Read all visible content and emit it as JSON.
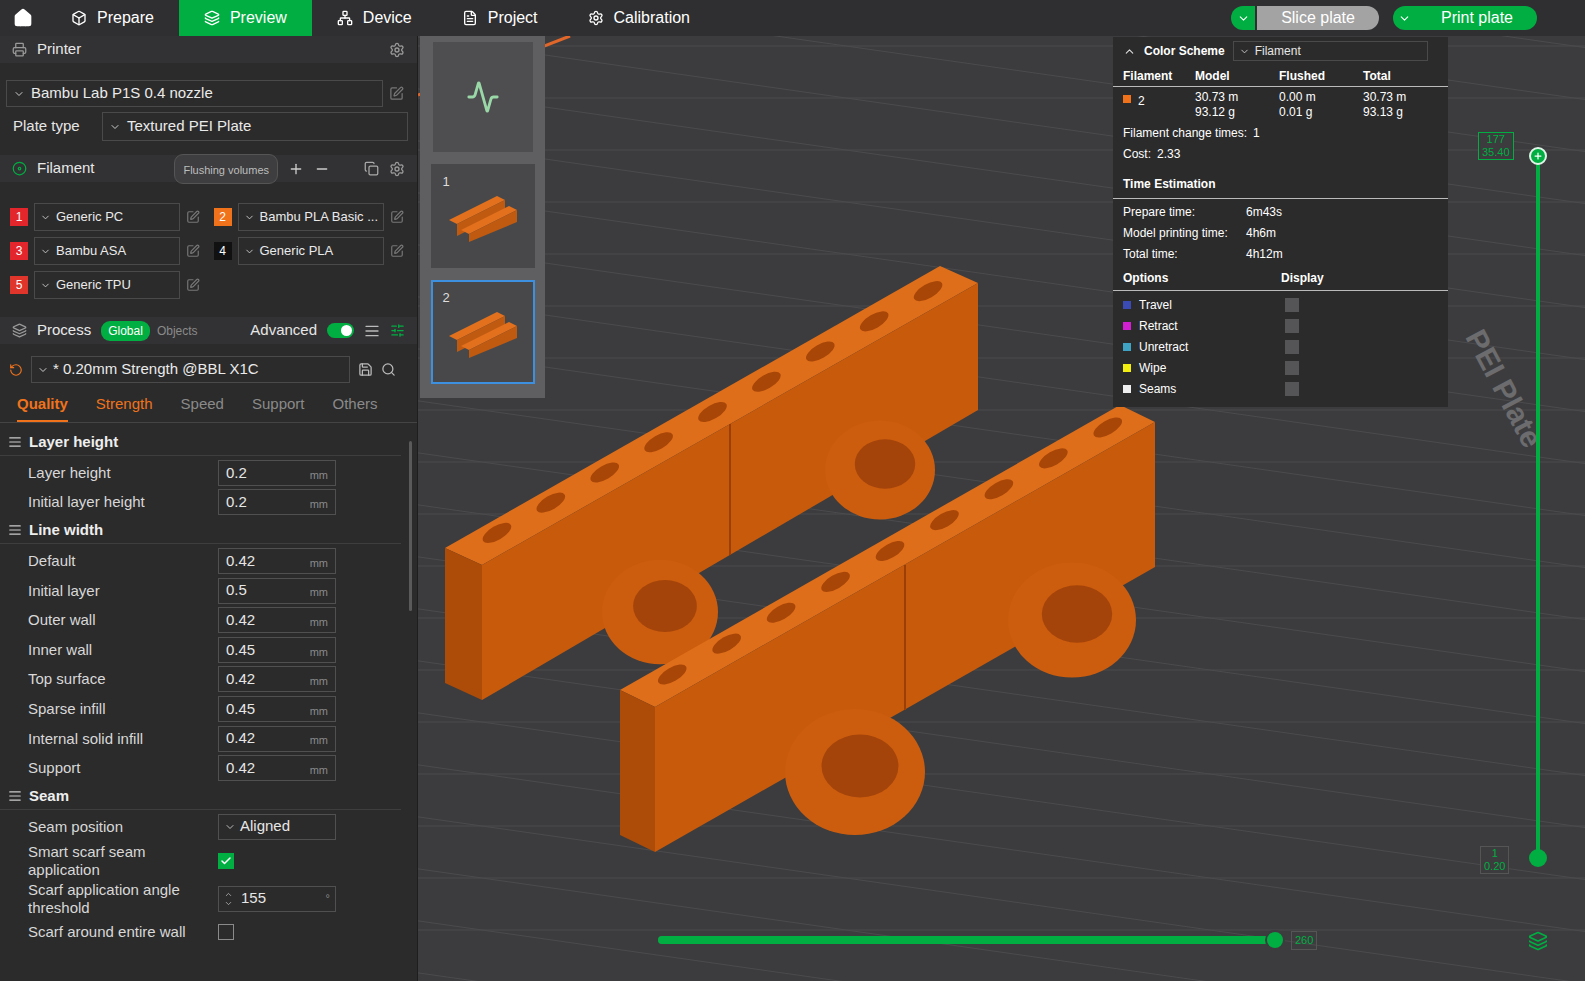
{
  "nav": {
    "tabs": [
      {
        "label": "Prepare",
        "selected": false
      },
      {
        "label": "Preview",
        "selected": true
      },
      {
        "label": "Device",
        "selected": false
      },
      {
        "label": "Project",
        "selected": false
      },
      {
        "label": "Calibration",
        "selected": false
      }
    ],
    "buttons": [
      {
        "label": "Slice plate",
        "primary": false
      },
      {
        "label": "Print plate",
        "primary": true
      }
    ]
  },
  "printer": {
    "title": "Printer",
    "preset": "Bambu Lab P1S 0.4 nozzle",
    "plate_type_label": "Plate type",
    "plate_type": "Textured PEI Plate"
  },
  "filament": {
    "title": "Filament",
    "flushing_button": "Flushing volumes",
    "items": [
      {
        "index": "1",
        "name": "Generic PC",
        "color": "#e3262b"
      },
      {
        "index": "2",
        "name": "Bambu PLA Basic ...",
        "color": "#f0731c"
      },
      {
        "index": "3",
        "name": "Bambu ASA",
        "color": "#e3262b"
      },
      {
        "index": "4",
        "name": "Generic PLA",
        "color": "#111111"
      },
      {
        "index": "5",
        "name": "Generic TPU",
        "color": "#e0352b"
      }
    ]
  },
  "process": {
    "title": "Process",
    "scope": [
      {
        "label": "Global",
        "selected": true
      },
      {
        "label": "Objects",
        "selected": false
      }
    ],
    "advanced_label": "Advanced",
    "advanced_on": true,
    "preset": "* 0.20mm Strength @BBL X1C",
    "tabs": [
      {
        "label": "Quality",
        "selected": true,
        "modified": true
      },
      {
        "label": "Strength",
        "selected": false,
        "modified": true
      },
      {
        "label": "Speed",
        "selected": false,
        "modified": false
      },
      {
        "label": "Support",
        "selected": false,
        "modified": false
      },
      {
        "label": "Others",
        "selected": false,
        "modified": false
      }
    ],
    "groups": [
      {
        "title": "Layer height",
        "rows": [
          {
            "kind": "number",
            "label": "Layer height",
            "value": "0.2",
            "unit": "mm"
          },
          {
            "kind": "number",
            "label": "Initial layer height",
            "value": "0.2",
            "unit": "mm"
          }
        ]
      },
      {
        "title": "Line width",
        "rows": [
          {
            "kind": "number",
            "label": "Default",
            "value": "0.42",
            "unit": "mm"
          },
          {
            "kind": "number",
            "label": "Initial layer",
            "value": "0.5",
            "unit": "mm"
          },
          {
            "kind": "number",
            "label": "Outer wall",
            "value": "0.42",
            "unit": "mm"
          },
          {
            "kind": "number",
            "label": "Inner wall",
            "value": "0.45",
            "unit": "mm"
          },
          {
            "kind": "number",
            "label": "Top surface",
            "value": "0.42",
            "unit": "mm"
          },
          {
            "kind": "number",
            "label": "Sparse infill",
            "value": "0.45",
            "unit": "mm"
          },
          {
            "kind": "number",
            "label": "Internal solid infill",
            "value": "0.42",
            "unit": "mm"
          },
          {
            "kind": "number",
            "label": "Support",
            "value": "0.42",
            "unit": "mm"
          }
        ]
      },
      {
        "title": "Seam",
        "rows": [
          {
            "kind": "select",
            "label": "Seam position",
            "value": "Aligned"
          },
          {
            "kind": "checkbox",
            "label": "Smart scarf seam application",
            "checked": true
          },
          {
            "kind": "spin",
            "label": "Scarf application angle threshold",
            "value": "155",
            "unit": "°"
          },
          {
            "kind": "checkbox",
            "label": "Scarf around entire wall",
            "checked": false
          }
        ]
      }
    ]
  },
  "plates": [
    {
      "label": "1",
      "selected": false
    },
    {
      "label": "2",
      "selected": true
    }
  ],
  "legend": {
    "title": "Color Scheme",
    "scheme": "Filament",
    "columns": [
      "Filament",
      "Model",
      "Flushed",
      "Total"
    ],
    "rows": [
      {
        "filament": "2",
        "color": "#f0731c",
        "model": [
          "30.73 m",
          "93.12 g"
        ],
        "flushed": [
          "0.00 m",
          "0.01 g"
        ],
        "total": [
          "30.73 m",
          "93.13 g"
        ]
      }
    ],
    "stats": [
      {
        "label": "Filament change times:",
        "value": "1"
      },
      {
        "label": "Cost:",
        "value": "2.33"
      }
    ],
    "time_title": "Time Estimation",
    "times": [
      {
        "label": "Prepare time:",
        "value": "6m43s"
      },
      {
        "label": "Model printing time:",
        "value": "4h6m"
      },
      {
        "label": "Total time:",
        "value": "4h12m"
      }
    ],
    "options_title": "Options",
    "display_title": "Display",
    "options": [
      {
        "label": "Travel",
        "color": "#3a4bb5",
        "checked": false
      },
      {
        "label": "Retract",
        "color": "#d21fd2",
        "checked": false
      },
      {
        "label": "Unretract",
        "color": "#3fa3c4",
        "checked": false
      },
      {
        "label": "Wipe",
        "color": "#f2ef10",
        "checked": false
      },
      {
        "label": "Seams",
        "color": "#eeeeee",
        "checked": false
      }
    ]
  },
  "layer_slider": {
    "top": {
      "layer": "177",
      "height": "35.40"
    },
    "bottom": {
      "layer": "1",
      "height": "0.20"
    },
    "upper_level": 1,
    "lower_level": 0
  },
  "move_slider": {
    "value": "260",
    "level": 1
  },
  "bed_label": "PEI Plate"
}
